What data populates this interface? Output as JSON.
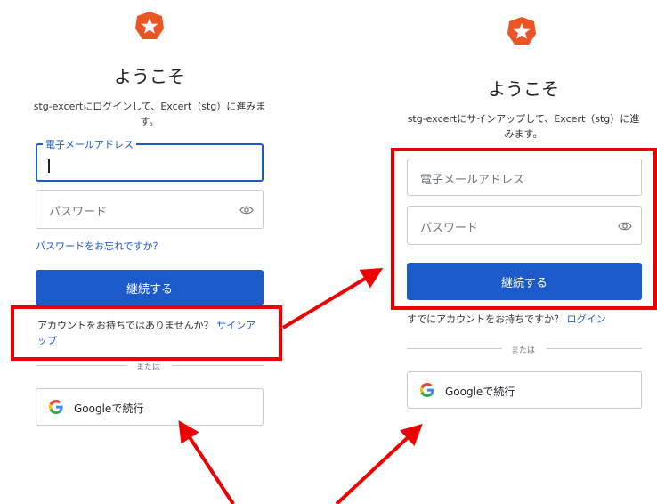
{
  "colors": {
    "accent": "#1b5ac8",
    "logo": "#eb5424",
    "highlight": "#ee0000"
  },
  "left": {
    "logo_icon": "auth0-star-icon",
    "title": "ようこそ",
    "subtitle_line1": "stg-excertにログインして、Excert（stg）に進みま",
    "subtitle_line2": "す。",
    "email_label": "電子メールアドレス",
    "password_placeholder": "パスワード",
    "forgot_link": "パスワードをお忘れですか？",
    "continue_label": "継続する",
    "no_account_text": "アカウントをお持ちではありませんか？",
    "signup_link_part1": "サインア",
    "signup_link_part2": "ップ",
    "or_text": "または",
    "google_label": "Googleで続行"
  },
  "right": {
    "logo_icon": "auth0-star-icon",
    "title": "ようこそ",
    "subtitle_line1": "stg-excertにサインアップして、Excert（stg）に進",
    "subtitle_line2": "みます。",
    "email_placeholder": "電子メールアドレス",
    "password_placeholder": "パスワード",
    "continue_label": "継続する",
    "have_account_text": "すでにアカウントをお持ちですか？",
    "login_link": "ログイン",
    "or_text": "または",
    "google_label": "Googleで続行"
  }
}
